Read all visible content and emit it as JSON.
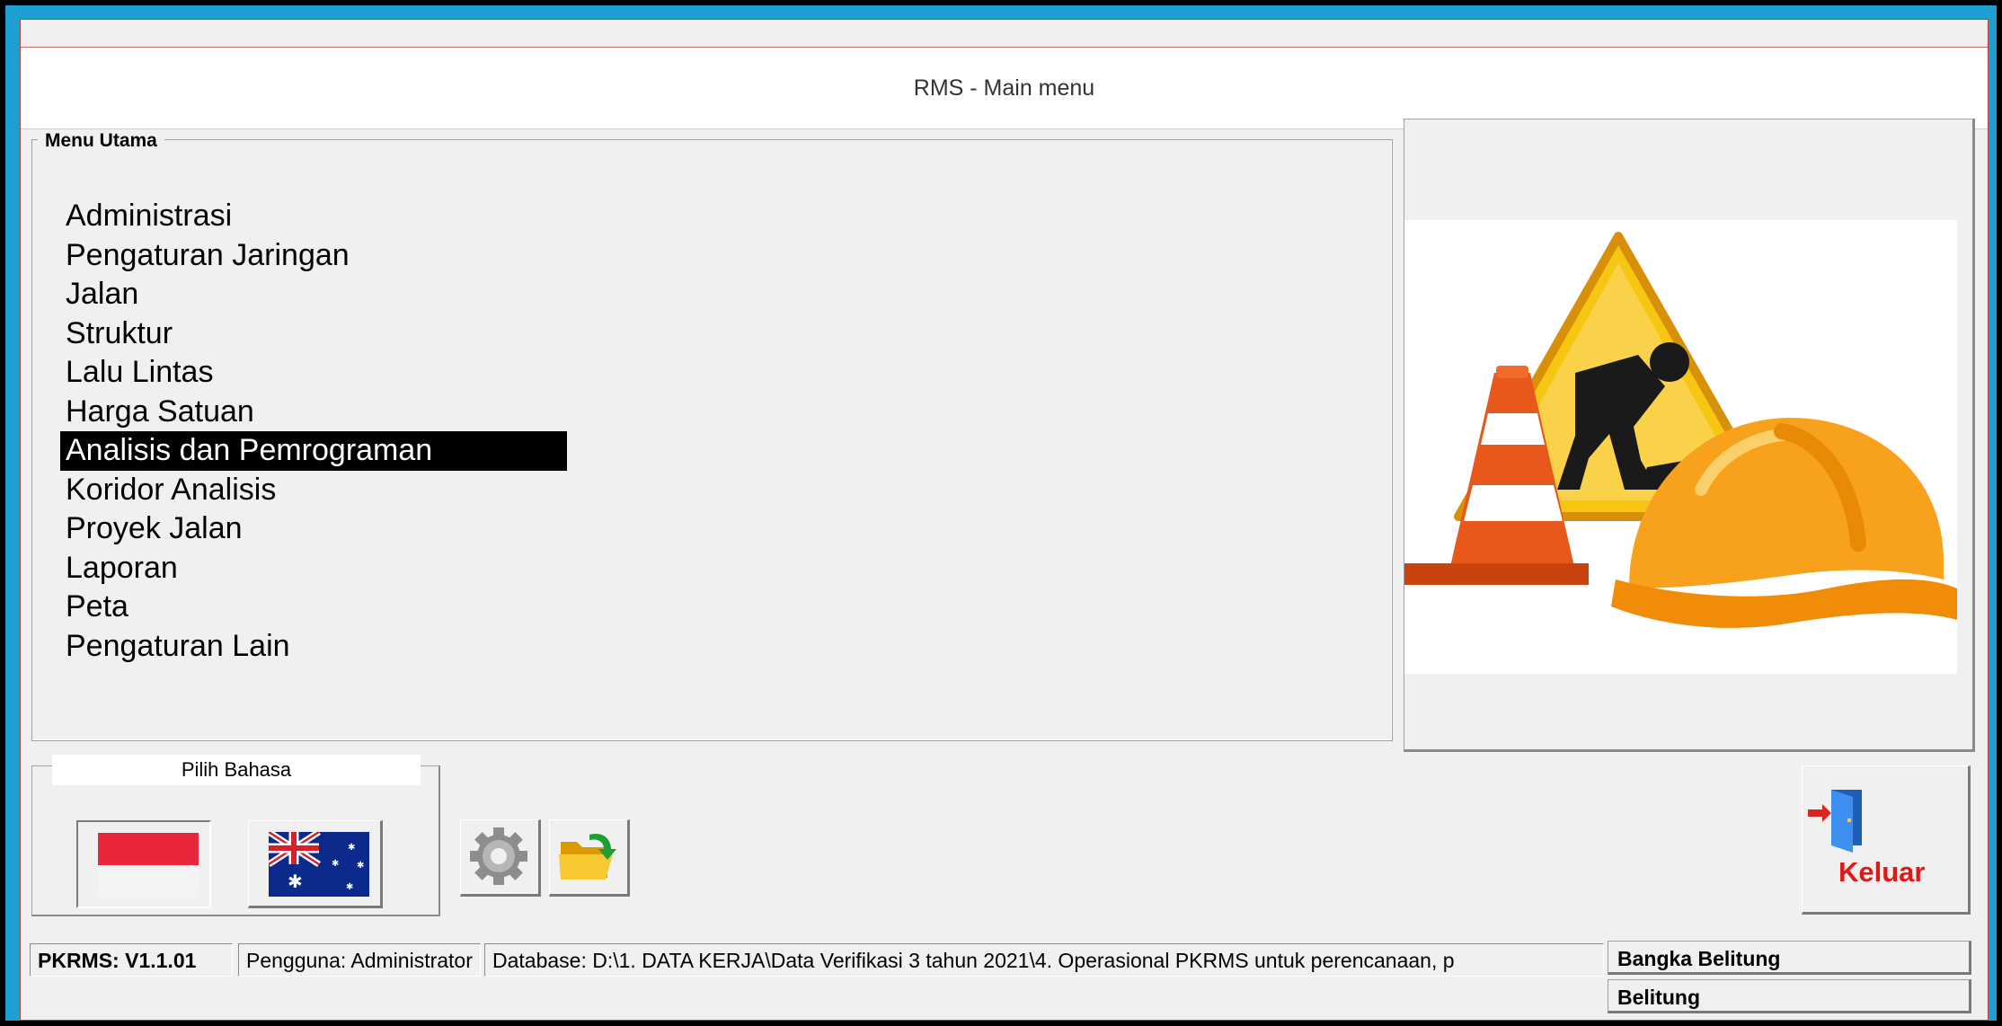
{
  "window": {
    "title": "RMS - Main menu"
  },
  "menu": {
    "legend": "Menu Utama",
    "items": [
      {
        "label": "Administrasi",
        "selected": false
      },
      {
        "label": "Pengaturan Jaringan",
        "selected": false
      },
      {
        "label": "Jalan",
        "selected": false
      },
      {
        "label": "Struktur",
        "selected": false
      },
      {
        "label": "Lalu Lintas",
        "selected": false
      },
      {
        "label": "Harga Satuan",
        "selected": false
      },
      {
        "label": "Analisis dan Pemrograman",
        "selected": true
      },
      {
        "label": "Koridor Analisis",
        "selected": false
      },
      {
        "label": "Proyek Jalan",
        "selected": false
      },
      {
        "label": "Laporan",
        "selected": false
      },
      {
        "label": "Peta",
        "selected": false
      },
      {
        "label": "Pengaturan Lain",
        "selected": false
      }
    ]
  },
  "image_panel": {
    "illustration": "road-works-illustration-icon"
  },
  "language": {
    "legend": "Pilih Bahasa",
    "options": [
      {
        "icon": "indonesia-flag-icon",
        "selected": true
      },
      {
        "icon": "australia-flag-icon",
        "selected": false
      }
    ]
  },
  "toolbar": {
    "settings_icon": "gear-icon",
    "open_icon": "folder-open-icon"
  },
  "exit_button": {
    "label": "Keluar",
    "icon": "exit-door-icon"
  },
  "status_bar": {
    "version": "PKRMS: V1.1.01",
    "user": "Pengguna: Administrator",
    "database": "Database: D:\\1. DATA KERJA\\Data Verifikasi 3 tahun 2021\\4. Operasional PKRMS untuk perencanaan, p",
    "province": "Bangka Belitung",
    "region": "Belitung"
  },
  "colors": {
    "border_dark": "#000000",
    "border_accent": "#1d9fd1",
    "window_border": "#b8453e",
    "selection_bg": "#000000",
    "exit_text": "#e01818"
  }
}
